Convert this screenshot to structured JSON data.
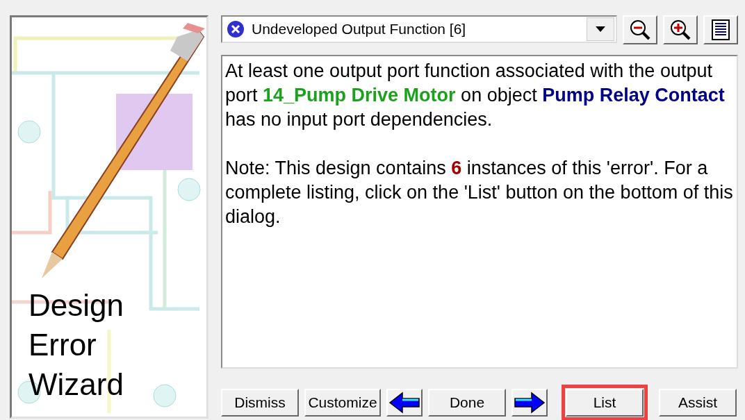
{
  "sidebar": {
    "title": "Design Error Wizard"
  },
  "error_select": {
    "value": "Undeveloped Output Function [6]"
  },
  "toolbar": [
    {
      "kind": "zoom-out"
    },
    {
      "kind": "zoom-in"
    },
    {
      "kind": "list"
    }
  ],
  "message": [
    [
      {
        "kind": "plain",
        "text": "At least one output port function associated with the output port "
      },
      {
        "kind": "port",
        "text": "14_Pump Drive Motor"
      },
      {
        "kind": "plain",
        "text": " on object "
      },
      {
        "kind": "object",
        "text": "Pump Relay Contact"
      },
      {
        "kind": "plain",
        "text": " has no input port dependencies."
      }
    ],
    [
      {
        "kind": "plain",
        "text": "Note: This design contains "
      },
      {
        "kind": "count",
        "text": "6"
      },
      {
        "kind": "plain",
        "text": " instances of this 'error'. For a complete listing, click on the 'List' button on the bottom of this dialog."
      }
    ]
  ],
  "buttons": [
    {
      "kind": "text",
      "label": "Dismiss",
      "highlighted": false
    },
    {
      "kind": "text",
      "label": "Customize",
      "highlighted": false
    },
    {
      "kind": "arrow-left",
      "highlighted": false
    },
    {
      "kind": "text",
      "label": "Done",
      "highlighted": false
    },
    {
      "kind": "arrow-right",
      "highlighted": false
    },
    {
      "kind": "text",
      "label": "List",
      "highlighted": true
    },
    {
      "kind": "text",
      "label": "Assist",
      "highlighted": false
    }
  ]
}
